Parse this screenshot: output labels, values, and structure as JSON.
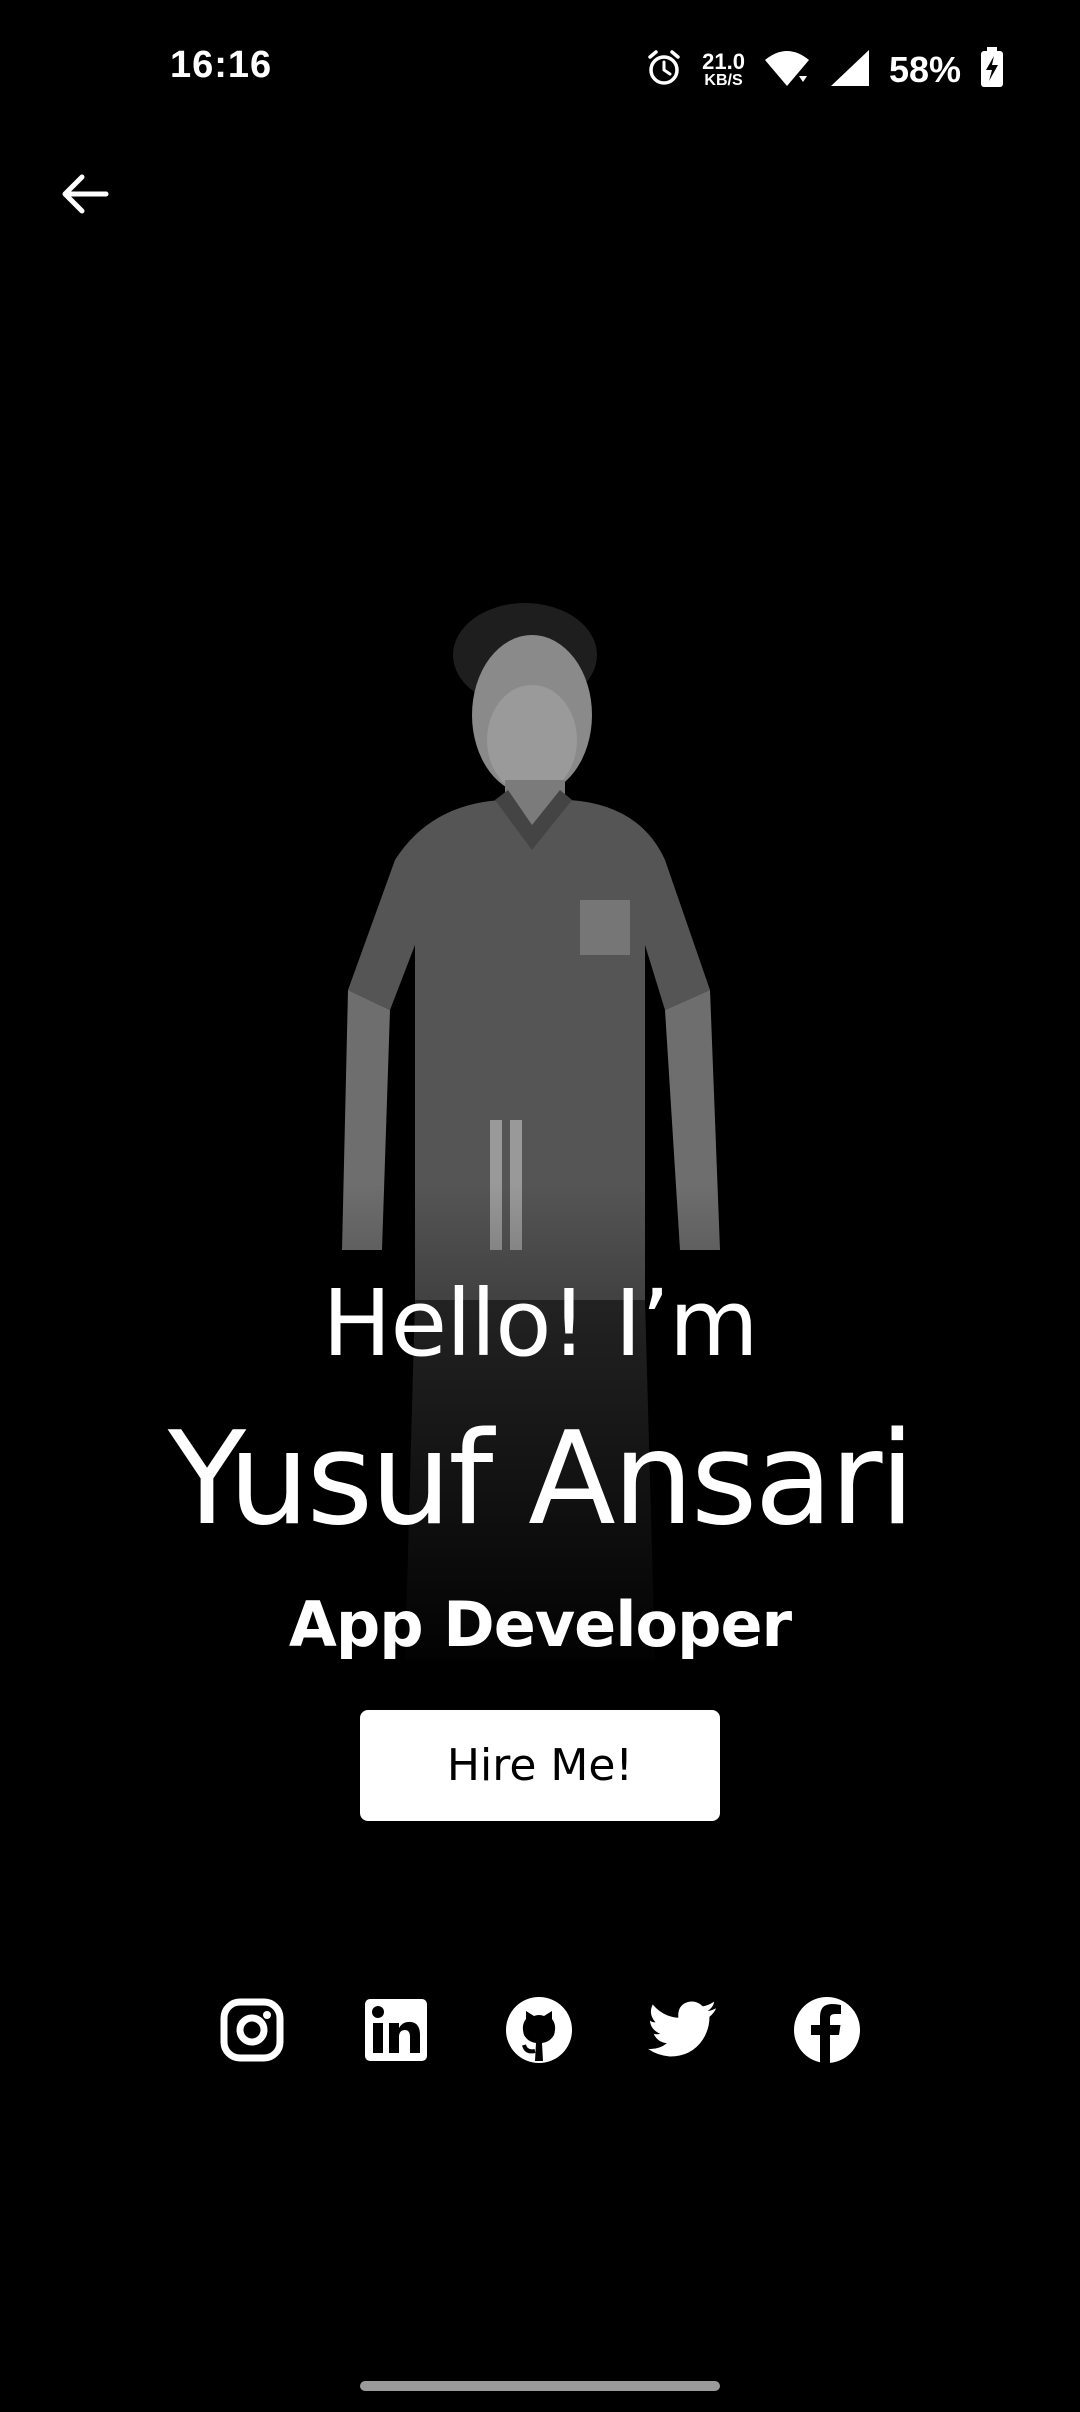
{
  "status_bar": {
    "time": "16:16",
    "net_speed_value": "21.0",
    "net_speed_unit": "KB/S",
    "battery": "58%",
    "icons": [
      "alarm-icon",
      "wifi-icon",
      "cellular-signal-icon",
      "battery-charging-icon"
    ]
  },
  "nav": {
    "back_icon": "arrow-left-icon"
  },
  "hero": {
    "greeting": "Hello! I’m",
    "name": "Yusuf Ansari",
    "role": "App Developer",
    "cta_label": "Hire Me!"
  },
  "socials": [
    {
      "icon": "instagram-icon"
    },
    {
      "icon": "linkedin-icon"
    },
    {
      "icon": "github-icon"
    },
    {
      "icon": "twitter-icon"
    },
    {
      "icon": "facebook-icon"
    }
  ],
  "colors": {
    "background": "#000000",
    "text": "#ffffff",
    "button_bg": "#ffffff",
    "button_text": "#000000"
  }
}
